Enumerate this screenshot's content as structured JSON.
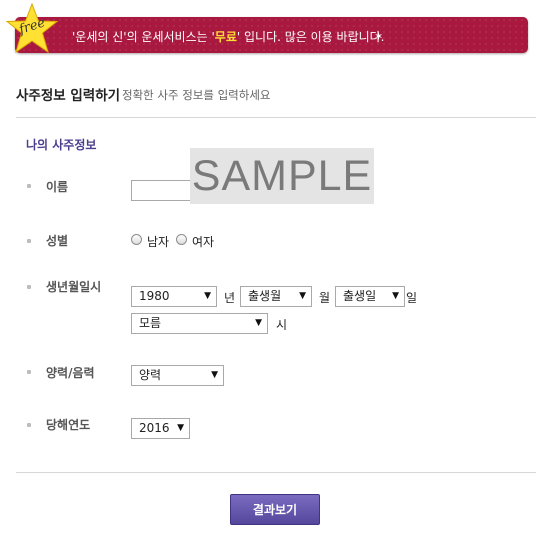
{
  "banner": {
    "badge": "free",
    "text_prefix": "'운세의 신'의 운세서비스는 '",
    "text_free": "무료",
    "text_suffix": "' 입니다. 많은 이용 바랍니다.",
    "sparkle": "✶"
  },
  "header": {
    "title": "사주정보 입력하기",
    "subtitle": "정확한 사주 정보를 입력하세요"
  },
  "section": {
    "title": "나의 사주정보"
  },
  "watermark": "SAMPLE",
  "form": {
    "name": {
      "label": "이름",
      "value": ""
    },
    "gender": {
      "label": "성별",
      "options": [
        "남자",
        "여자"
      ]
    },
    "birth": {
      "label": "생년월일시",
      "year": "1980",
      "year_unit": "년",
      "month": "출생월",
      "month_unit": "월",
      "day": "출생일",
      "day_unit": "일",
      "hour": "모름",
      "hour_unit": "시"
    },
    "calendar": {
      "label": "양력/음력",
      "value": "양력"
    },
    "target_year": {
      "label": "당해연도",
      "value": "2016"
    }
  },
  "submit_label": "결과보기",
  "colors": {
    "banner": "#a8183f",
    "accent": "#4c3d8f",
    "button": "#5b4ea6",
    "highlight": "#ffdd33"
  }
}
